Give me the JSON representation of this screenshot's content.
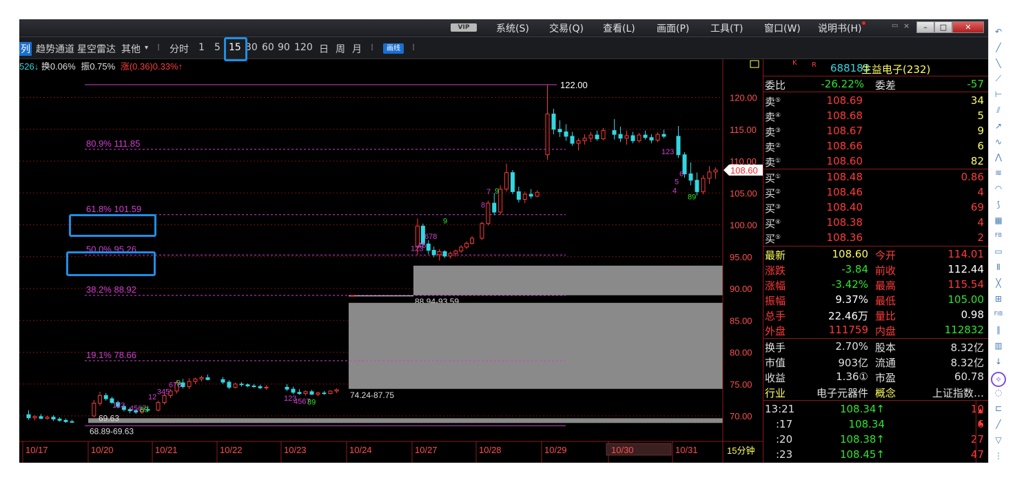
{
  "menubar": {
    "vip": "VIP",
    "items": [
      "系统(S)",
      "交易(Q)",
      "查看(L)",
      "画面(P)",
      "工具(T)",
      "窗口(W)",
      "说明书(H)"
    ]
  },
  "toolbar": {
    "items": [
      "列",
      "趋势通道",
      "星空雷达",
      "其他",
      "分时",
      "1",
      "5",
      "15",
      "30",
      "60",
      "90",
      "120",
      "日",
      "周",
      "月"
    ],
    "draw_label": "画线",
    "selected_period": "15"
  },
  "info_line": {
    "prefix": "526↓",
    "turnover": "换0.06%",
    "amplitude": "振0.75%",
    "change": "涨(0.36)0.33%↑"
  },
  "chart_data": {
    "type": "candlestick",
    "period_label": "15分钟",
    "ylim": [
      66,
      126
    ],
    "y_ticks": [
      70,
      75,
      80,
      85,
      90,
      95,
      100,
      105,
      110,
      115,
      120
    ],
    "y_tick_labels": [
      "70.00",
      "75.00",
      "80.00",
      "85.00",
      "90.00",
      "95.00",
      "100.00",
      "105.00",
      "110.00",
      "115.00",
      "120.00"
    ],
    "x_dates": [
      "10/17",
      "10/20",
      "10/21",
      "10/22",
      "10/23",
      "10/24",
      "10/27",
      "10/28",
      "10/29",
      "10/30",
      "10/31"
    ],
    "current_price": "108.60",
    "high_marker": "122.00",
    "fibonacci": [
      {
        "label": "80.9% 111.85",
        "value": 111.85
      },
      {
        "label": "61.8% 101.59",
        "value": 101.59
      },
      {
        "label": "50.0% 95.26",
        "value": 95.26
      },
      {
        "label": "38.2% 88.92",
        "value": 88.92
      },
      {
        "label": "19.1% 78.66",
        "value": 78.66
      }
    ],
    "top_line_value": 122.0,
    "bottom_line_value": 68.89,
    "gaps": [
      {
        "label": "88.94-93.59",
        "low": 88.94,
        "high": 93.59
      },
      {
        "label": "74.24-87.75",
        "low": 74.24,
        "high": 87.75
      },
      {
        "label": "68.89-69.63",
        "low": 68.89,
        "high": 69.63
      }
    ],
    "stray_labels": [
      "69.63"
    ],
    "td_counts": [
      {
        "text": "123",
        "value": 71.3
      },
      {
        "text": "4567",
        "value": 70.8
      },
      {
        "text": "89",
        "value": 70.6
      },
      {
        "text": "12",
        "value": 72.6
      },
      {
        "text": "345",
        "value": 73.4
      },
      {
        "text": "678",
        "value": 74.5
      },
      {
        "text": "9",
        "value": 74.8
      },
      {
        "text": "123",
        "value": 72.4
      },
      {
        "text": "4567",
        "value": 71.9
      },
      {
        "text": "89",
        "value": 71.8
      },
      {
        "text": "123",
        "value": 95.9
      },
      {
        "text": "45",
        "value": 96.4
      },
      {
        "text": "678",
        "value": 97.8
      },
      {
        "text": "9",
        "value": 100.2
      },
      {
        "text": "7",
        "value": 104.8
      },
      {
        "text": "8",
        "value": 102.7
      },
      {
        "text": "9",
        "value": 104.9
      },
      {
        "text": "123",
        "value": 111.1
      },
      {
        "text": "6",
        "value": 107.6
      },
      {
        "text": "5",
        "value": 106.4
      },
      {
        "text": "4",
        "value": 105.0
      },
      {
        "text": "89",
        "value": 104.0
      }
    ],
    "candles": [
      {
        "d": 0,
        "o": 70.2,
        "h": 70.9,
        "l": 69.4,
        "c": 69.7
      },
      {
        "d": 0,
        "o": 69.7,
        "h": 70.1,
        "l": 69.3,
        "c": 69.9
      },
      {
        "d": 0,
        "o": 69.9,
        "h": 70.3,
        "l": 69.5,
        "c": 69.6
      },
      {
        "d": 0,
        "o": 69.6,
        "h": 70.0,
        "l": 69.4,
        "c": 69.8
      },
      {
        "d": 0,
        "o": 69.8,
        "h": 70.1,
        "l": 69.2,
        "c": 69.5
      },
      {
        "d": 0,
        "o": 69.5,
        "h": 69.8,
        "l": 69.1,
        "c": 69.3
      },
      {
        "d": 0,
        "o": 69.3,
        "h": 69.6,
        "l": 68.9,
        "c": 69.1
      },
      {
        "d": 0,
        "o": 69.1,
        "h": 69.4,
        "l": 68.9,
        "c": 69.0
      },
      {
        "d": 1,
        "o": 70.0,
        "h": 72.5,
        "l": 69.8,
        "c": 72.0
      },
      {
        "d": 1,
        "o": 72.0,
        "h": 73.8,
        "l": 71.6,
        "c": 73.2
      },
      {
        "d": 1,
        "o": 73.2,
        "h": 73.6,
        "l": 72.4,
        "c": 72.7
      },
      {
        "d": 1,
        "o": 72.7,
        "h": 73.0,
        "l": 71.9,
        "c": 72.1
      },
      {
        "d": 1,
        "o": 72.1,
        "h": 72.4,
        "l": 71.2,
        "c": 71.5
      },
      {
        "d": 1,
        "o": 71.5,
        "h": 71.8,
        "l": 70.7,
        "c": 71.0
      },
      {
        "d": 1,
        "o": 71.0,
        "h": 71.3,
        "l": 70.4,
        "c": 70.8
      },
      {
        "d": 1,
        "o": 70.8,
        "h": 71.1,
        "l": 70.3,
        "c": 70.6
      },
      {
        "d": 1,
        "o": 70.6,
        "h": 71.2,
        "l": 70.3,
        "c": 71.0
      },
      {
        "d": 1,
        "o": 71.0,
        "h": 71.6,
        "l": 70.6,
        "c": 70.9
      },
      {
        "d": 2,
        "o": 70.9,
        "h": 72.4,
        "l": 70.7,
        "c": 72.1
      },
      {
        "d": 2,
        "o": 72.1,
        "h": 73.5,
        "l": 71.8,
        "c": 73.2
      },
      {
        "d": 2,
        "o": 73.2,
        "h": 74.2,
        "l": 72.8,
        "c": 73.9
      },
      {
        "d": 2,
        "o": 73.9,
        "h": 75.6,
        "l": 73.5,
        "c": 75.2
      },
      {
        "d": 2,
        "o": 75.2,
        "h": 75.8,
        "l": 74.3,
        "c": 74.6
      },
      {
        "d": 2,
        "o": 74.6,
        "h": 75.9,
        "l": 74.2,
        "c": 75.4
      },
      {
        "d": 2,
        "o": 75.4,
        "h": 76.0,
        "l": 75.0,
        "c": 75.8
      },
      {
        "d": 2,
        "o": 75.8,
        "h": 76.3,
        "l": 75.4,
        "c": 76.0
      },
      {
        "d": 2,
        "o": 76.0,
        "h": 76.5,
        "l": 75.6,
        "c": 75.7
      },
      {
        "d": 3,
        "o": 75.7,
        "h": 76.1,
        "l": 75.0,
        "c": 75.3
      },
      {
        "d": 3,
        "o": 75.3,
        "h": 75.6,
        "l": 74.2,
        "c": 74.5
      },
      {
        "d": 3,
        "o": 74.5,
        "h": 75.2,
        "l": 74.3,
        "c": 75.0
      },
      {
        "d": 3,
        "o": 75.0,
        "h": 75.3,
        "l": 74.6,
        "c": 74.9
      },
      {
        "d": 3,
        "o": 74.9,
        "h": 75.1,
        "l": 74.5,
        "c": 74.7
      },
      {
        "d": 3,
        "o": 74.7,
        "h": 75.0,
        "l": 74.4,
        "c": 74.6
      },
      {
        "d": 3,
        "o": 74.6,
        "h": 74.9,
        "l": 74.2,
        "c": 74.4
      },
      {
        "d": 3,
        "o": 74.4,
        "h": 74.8,
        "l": 74.1,
        "c": 74.5
      },
      {
        "d": 4,
        "o": 74.5,
        "h": 75.0,
        "l": 73.9,
        "c": 74.2
      },
      {
        "d": 4,
        "o": 74.2,
        "h": 74.6,
        "l": 73.4,
        "c": 73.7
      },
      {
        "d": 4,
        "o": 73.7,
        "h": 74.2,
        "l": 73.3,
        "c": 73.5
      },
      {
        "d": 4,
        "o": 73.5,
        "h": 74.0,
        "l": 73.2,
        "c": 73.8
      },
      {
        "d": 4,
        "o": 73.8,
        "h": 74.1,
        "l": 73.3,
        "c": 73.4
      },
      {
        "d": 4,
        "o": 73.4,
        "h": 73.8,
        "l": 73.1,
        "c": 73.6
      },
      {
        "d": 4,
        "o": 73.6,
        "h": 73.9,
        "l": 73.3,
        "c": 73.5
      },
      {
        "d": 4,
        "o": 73.5,
        "h": 74.0,
        "l": 73.4,
        "c": 73.9
      },
      {
        "d": 4,
        "o": 73.9,
        "h": 74.3,
        "l": 73.6,
        "c": 74.1
      },
      {
        "d": 5,
        "o": 88.9,
        "h": 88.9,
        "l": 88.9,
        "c": 88.9
      },
      {
        "d": 6,
        "o": 96.5,
        "h": 101.0,
        "l": 95.3,
        "c": 99.8
      },
      {
        "d": 6,
        "o": 99.8,
        "h": 100.2,
        "l": 96.5,
        "c": 97.0
      },
      {
        "d": 6,
        "o": 97.0,
        "h": 97.6,
        "l": 95.4,
        "c": 96.0
      },
      {
        "d": 6,
        "o": 96.0,
        "h": 96.6,
        "l": 94.9,
        "c": 95.3
      },
      {
        "d": 6,
        "o": 95.3,
        "h": 96.2,
        "l": 94.4,
        "c": 95.8
      },
      {
        "d": 6,
        "o": 95.8,
        "h": 96.0,
        "l": 94.8,
        "c": 95.1
      },
      {
        "d": 6,
        "o": 95.1,
        "h": 95.8,
        "l": 94.7,
        "c": 95.5
      },
      {
        "d": 6,
        "o": 95.5,
        "h": 96.1,
        "l": 95.0,
        "c": 95.9
      },
      {
        "d": 6,
        "o": 95.9,
        "h": 96.8,
        "l": 95.6,
        "c": 96.5
      },
      {
        "d": 6,
        "o": 96.5,
        "h": 97.4,
        "l": 96.2,
        "c": 97.1
      },
      {
        "d": 6,
        "o": 97.1,
        "h": 98.2,
        "l": 96.9,
        "c": 97.9
      },
      {
        "d": 7,
        "o": 97.9,
        "h": 100.5,
        "l": 97.6,
        "c": 100.2
      },
      {
        "d": 7,
        "o": 100.2,
        "h": 103.8,
        "l": 99.9,
        "c": 103.4
      },
      {
        "d": 7,
        "o": 103.4,
        "h": 105.0,
        "l": 101.5,
        "c": 102.0
      },
      {
        "d": 7,
        "o": 102.0,
        "h": 106.2,
        "l": 101.6,
        "c": 105.6
      },
      {
        "d": 7,
        "o": 105.6,
        "h": 109.6,
        "l": 105.2,
        "c": 108.2
      },
      {
        "d": 7,
        "o": 108.2,
        "h": 108.6,
        "l": 104.8,
        "c": 105.2
      },
      {
        "d": 7,
        "o": 105.2,
        "h": 106.0,
        "l": 103.5,
        "c": 104.0
      },
      {
        "d": 7,
        "o": 104.0,
        "h": 105.2,
        "l": 103.4,
        "c": 104.8
      },
      {
        "d": 7,
        "o": 104.8,
        "h": 105.6,
        "l": 104.1,
        "c": 104.5
      },
      {
        "d": 7,
        "o": 104.5,
        "h": 105.4,
        "l": 104.3,
        "c": 105.1
      },
      {
        "d": 8,
        "o": 111.0,
        "h": 122.0,
        "l": 110.2,
        "c": 117.4
      },
      {
        "d": 8,
        "o": 117.4,
        "h": 118.2,
        "l": 114.2,
        "c": 115.0
      },
      {
        "d": 8,
        "o": 115.0,
        "h": 116.4,
        "l": 113.8,
        "c": 114.6
      },
      {
        "d": 8,
        "o": 114.6,
        "h": 115.8,
        "l": 113.2,
        "c": 113.9
      },
      {
        "d": 8,
        "o": 113.9,
        "h": 114.6,
        "l": 112.4,
        "c": 112.8
      },
      {
        "d": 8,
        "o": 112.8,
        "h": 113.6,
        "l": 111.7,
        "c": 113.2
      },
      {
        "d": 8,
        "o": 113.2,
        "h": 114.2,
        "l": 112.6,
        "c": 113.6
      },
      {
        "d": 8,
        "o": 113.6,
        "h": 114.6,
        "l": 113.0,
        "c": 114.1
      },
      {
        "d": 8,
        "o": 114.1,
        "h": 114.8,
        "l": 113.2,
        "c": 113.5
      },
      {
        "d": 8,
        "o": 113.5,
        "h": 115.2,
        "l": 113.3,
        "c": 114.8
      },
      {
        "d": 9,
        "o": 114.8,
        "h": 116.6,
        "l": 113.4,
        "c": 114.2
      },
      {
        "d": 9,
        "o": 114.2,
        "h": 115.4,
        "l": 113.0,
        "c": 113.6
      },
      {
        "d": 9,
        "o": 113.6,
        "h": 114.8,
        "l": 112.6,
        "c": 114.0
      },
      {
        "d": 9,
        "o": 114.0,
        "h": 114.6,
        "l": 112.8,
        "c": 113.2
      },
      {
        "d": 9,
        "o": 113.2,
        "h": 114.4,
        "l": 112.9,
        "c": 114.1
      },
      {
        "d": 9,
        "o": 114.1,
        "h": 114.8,
        "l": 113.4,
        "c": 113.7
      },
      {
        "d": 9,
        "o": 113.7,
        "h": 114.2,
        "l": 112.8,
        "c": 113.3
      },
      {
        "d": 9,
        "o": 113.3,
        "h": 114.5,
        "l": 113.0,
        "c": 114.2
      },
      {
        "d": 9,
        "o": 114.2,
        "h": 114.9,
        "l": 113.6,
        "c": 113.9
      },
      {
        "d": 10,
        "o": 113.9,
        "h": 115.5,
        "l": 110.5,
        "c": 111.0
      },
      {
        "d": 10,
        "o": 111.0,
        "h": 111.4,
        "l": 107.4,
        "c": 108.0
      },
      {
        "d": 10,
        "o": 108.0,
        "h": 109.8,
        "l": 106.2,
        "c": 107.0
      },
      {
        "d": 10,
        "o": 107.0,
        "h": 108.2,
        "l": 104.6,
        "c": 105.2
      },
      {
        "d": 10,
        "o": 105.2,
        "h": 107.8,
        "l": 104.8,
        "c": 107.3
      },
      {
        "d": 10,
        "o": 107.3,
        "h": 109.2,
        "l": 106.4,
        "c": 108.3
      },
      {
        "d": 10,
        "o": 108.3,
        "h": 109.0,
        "l": 107.2,
        "c": 108.6
      }
    ]
  },
  "stock": {
    "flags": [
      "K",
      "R"
    ],
    "code": "688183",
    "name": "生益电子(232)",
    "webi": {
      "label": "委比",
      "value": "-26.22%",
      "label2": "委差",
      "value2": "-57"
    },
    "asks": [
      {
        "label": "卖",
        "idx": "⑤",
        "price": "108.69",
        "vol": "34"
      },
      {
        "label": "卖",
        "idx": "④",
        "price": "108.68",
        "vol": "5"
      },
      {
        "label": "卖",
        "idx": "③",
        "price": "108.67",
        "vol": "9"
      },
      {
        "label": "卖",
        "idx": "②",
        "price": "108.66",
        "vol": "6"
      },
      {
        "label": "卖",
        "idx": "①",
        "price": "108.60",
        "vol": "82"
      }
    ],
    "bids": [
      {
        "label": "买",
        "idx": "①",
        "price": "108.48",
        "vol": "0.86"
      },
      {
        "label": "买",
        "idx": "②",
        "price": "108.46",
        "vol": "4"
      },
      {
        "label": "买",
        "idx": "③",
        "price": "108.40",
        "vol": "69"
      },
      {
        "label": "买",
        "idx": "④",
        "price": "108.38",
        "vol": "4"
      },
      {
        "label": "买",
        "idx": "⑤",
        "price": "108.36",
        "vol": "2"
      }
    ],
    "stats": [
      {
        "l1": "最新",
        "v1": "108.60",
        "l2": "今开",
        "v2": "114.01"
      },
      {
        "l1": "涨跌",
        "v1": "-3.84",
        "l2": "前收",
        "v2": "112.44"
      },
      {
        "l1": "涨幅",
        "v1": "-3.42%",
        "l2": "最高",
        "v2": "115.54"
      },
      {
        "l1": "振幅",
        "v1": "9.37%",
        "l2": "最低",
        "v2": "105.00"
      },
      {
        "l1": "总手",
        "v1": "22.46万",
        "l2": "量比",
        "v2": "0.98"
      },
      {
        "l1": "外盘",
        "v1": "111759",
        "l2": "内盘",
        "v2": "112832"
      }
    ],
    "stats2": [
      {
        "l1": "换手",
        "v1": "2.70%",
        "l2": "股本",
        "v2": "8.32亿"
      },
      {
        "l1": "市值",
        "v1": "903亿",
        "l2": "流通",
        "v2": "8.32亿"
      },
      {
        "l1": "收益",
        "v1": "1.36①",
        "l2": "市盈",
        "v2": "60.78"
      },
      {
        "l1": "行业",
        "v1": "电子元器件",
        "l2": "概念",
        "v2": "上证指数…"
      }
    ],
    "ticks": [
      {
        "time": "13:21",
        "price": "108.34↑",
        "vol": "10"
      },
      {
        "time": ":17",
        "price": "108.34",
        "vol": "6"
      },
      {
        "time": ":20",
        "price": "108.38↑",
        "vol": "27"
      },
      {
        "time": ":23",
        "price": "108.45↑",
        "vol": "47"
      }
    ]
  },
  "colors": {
    "up": "#ff3b3b",
    "down": "#33d6e0",
    "fib": "#d43fd4",
    "grid": "#7a1010",
    "label": "#ff5050",
    "value": "#ffff60",
    "green": "#2ee62e",
    "highlight": "#1f8fe6"
  }
}
